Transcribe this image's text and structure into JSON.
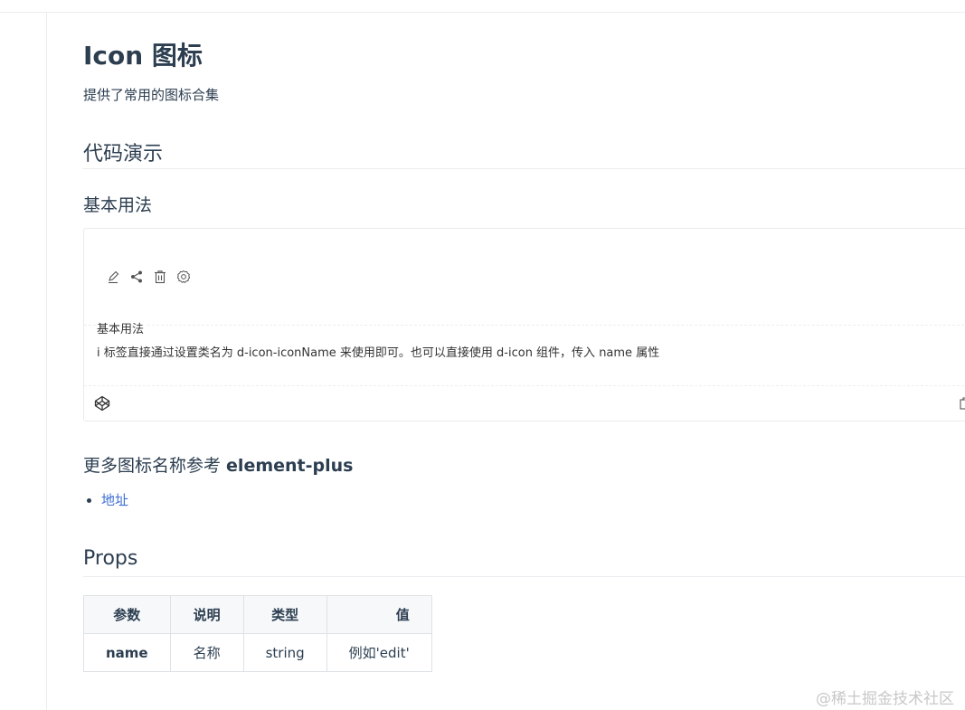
{
  "page": {
    "title": "Icon 图标",
    "description": "提供了常用的图标合集"
  },
  "sections": {
    "demo_heading": "代码演示",
    "basic_usage_heading": "基本用法",
    "more_icons_heading_prefix": "更多图标名称参考 ",
    "more_icons_heading_strong": "element-plus",
    "props_heading": "Props"
  },
  "demo": {
    "icons": [
      "edit-icon",
      "share-icon",
      "delete-icon",
      "setting-icon"
    ],
    "meta_title": "基本用法",
    "meta_description": "i 标签直接通过设置类名为 d-icon-iconName 来使用即可。也可以直接使用 d-icon 组件，传入 name 属性",
    "footer_icons": [
      "codepen-icon",
      "copy-icon"
    ]
  },
  "links": [
    {
      "label": "地址"
    }
  ],
  "props_table": {
    "headers": [
      "参数",
      "说明",
      "类型",
      "值"
    ],
    "rows": [
      [
        "name",
        "名称",
        "string",
        "例如'edit'"
      ]
    ]
  },
  "watermark": "@稀土掘金技术社区",
  "colors": {
    "text": "#2c3e50",
    "link": "#3e6fd2",
    "border": "#eaecef",
    "table_header_bg": "#f6f8fa"
  }
}
